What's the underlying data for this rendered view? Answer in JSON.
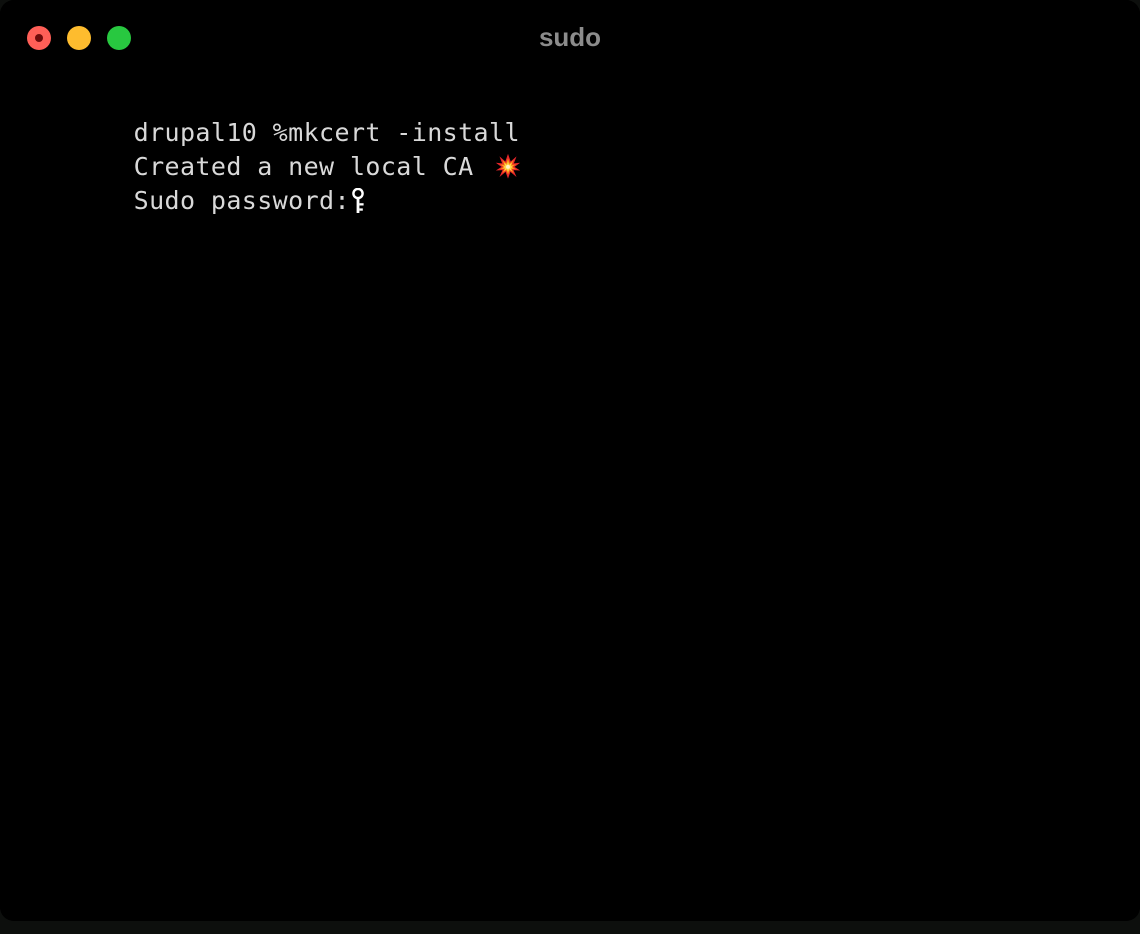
{
  "window": {
    "title": "sudo",
    "app_kind": "terminal",
    "background_color": "#000000",
    "desktop_background_color": "#0d0f0d",
    "text_color": "#d9d9d9",
    "title_color": "#8c8c8c"
  },
  "traffic_lights": [
    {
      "name": "close",
      "label": "Close",
      "color": "#ff5f57",
      "inner_dot_color": "#6e0b0b",
      "state": "hover"
    },
    {
      "name": "minimize",
      "label": "Minimize",
      "color": "#febc2e",
      "inner_dot_color": "",
      "state": "normal"
    },
    {
      "name": "zoom",
      "label": "Zoom",
      "color": "#28c840",
      "inner_dot_color": "",
      "state": "normal"
    }
  ],
  "terminal": {
    "lines": [
      {
        "id": "prompt-command",
        "text": "drupal10 %mkcert -install",
        "icon": ""
      },
      {
        "id": "created-ca",
        "text": "Created a new local CA ",
        "icon": "collision-emoji"
      },
      {
        "id": "sudo-password-prompt",
        "text": "Sudo password:",
        "icon": "key-emoji"
      }
    ],
    "input_value": "",
    "cursor_after": "sudo-password-prompt"
  }
}
